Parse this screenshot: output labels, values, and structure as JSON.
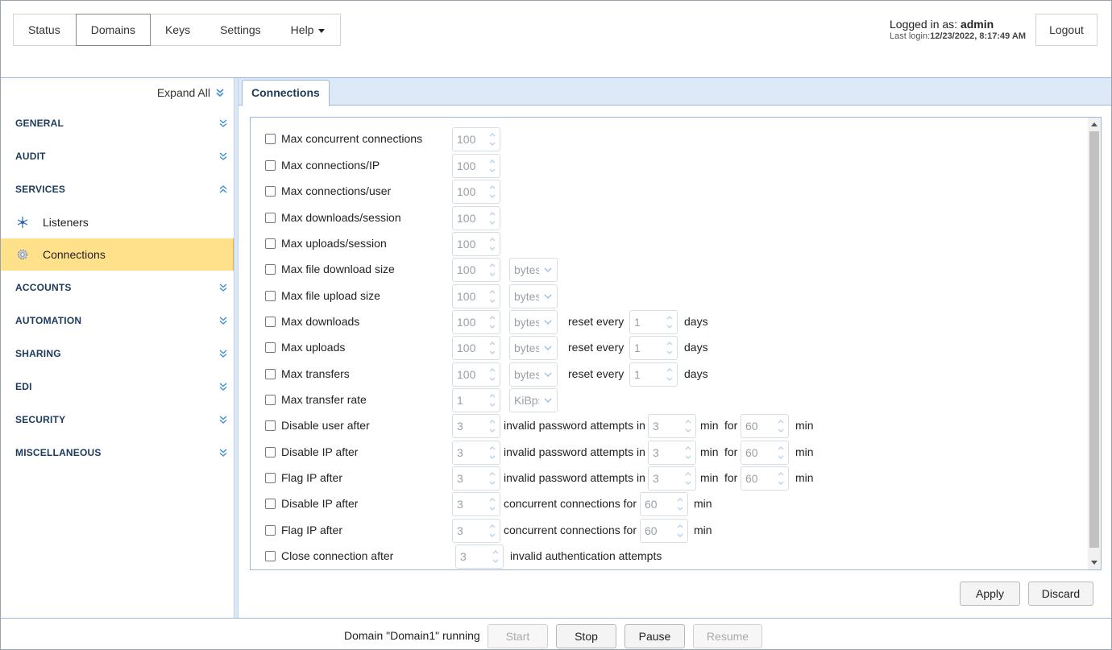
{
  "nav": {
    "items": [
      {
        "label": "Status",
        "name": "nav-status"
      },
      {
        "label": "Domains",
        "name": "nav-domains"
      },
      {
        "label": "Keys",
        "name": "nav-keys"
      },
      {
        "label": "Settings",
        "name": "nav-settings"
      },
      {
        "label": "Help",
        "name": "nav-help"
      }
    ],
    "active": "Domains"
  },
  "login": {
    "prefix": "Logged in as:",
    "user": "admin",
    "last_login_label": "Last login:",
    "last_login_value": "12/23/2022, 8:17:49 AM",
    "logout_label": "Logout"
  },
  "sidebar": {
    "expand_all": "Expand All",
    "sections": {
      "general": "GENERAL",
      "audit": "AUDIT",
      "services": "SERVICES",
      "accounts": "ACCOUNTS",
      "automation": "AUTOMATION",
      "sharing": "SHARING",
      "edi": "EDI",
      "security": "SECURITY",
      "misc": "MISCELLANEOUS"
    },
    "items": {
      "listeners": "Listeners",
      "connections": "Connections"
    }
  },
  "tab": {
    "label": "Connections"
  },
  "form": {
    "r1": {
      "label": "Max concurrent connections",
      "value": "100"
    },
    "r2": {
      "label": "Max connections/IP",
      "value": "100"
    },
    "r3": {
      "label": "Max connections/user",
      "value": "100"
    },
    "r4": {
      "label": "Max downloads/session",
      "value": "100"
    },
    "r5": {
      "label": "Max uploads/session",
      "value": "100"
    },
    "r6": {
      "label": "Max file download size",
      "value": "100",
      "unit": "bytes"
    },
    "r7": {
      "label": "Max file upload size",
      "value": "100",
      "unit": "bytes"
    },
    "r8": {
      "label": "Max downloads",
      "value": "100",
      "unit": "bytes",
      "reset_label": "reset every",
      "reset_value": "1",
      "reset_unit": "days"
    },
    "r9": {
      "label": "Max uploads",
      "value": "100",
      "unit": "bytes",
      "reset_label": "reset every",
      "reset_value": "1",
      "reset_unit": "days"
    },
    "r10": {
      "label": "Max transfers",
      "value": "100",
      "unit": "bytes",
      "reset_label": "reset every",
      "reset_value": "1",
      "reset_unit": "days"
    },
    "r11": {
      "label": "Max transfer rate",
      "value": "1",
      "unit": "KiBps"
    },
    "r12": {
      "label": "Disable user after",
      "value": "3",
      "mid": "invalid password attempts in",
      "in_value": "3",
      "in_unit": "min",
      "for_label": "for",
      "for_value": "60",
      "for_unit": "min"
    },
    "r13": {
      "label": "Disable IP after",
      "value": "3",
      "mid": "invalid password attempts in",
      "in_value": "3",
      "in_unit": "min",
      "for_label": "for",
      "for_value": "60",
      "for_unit": "min"
    },
    "r14": {
      "label": "Flag IP after",
      "value": "3",
      "mid": "invalid password attempts in",
      "in_value": "3",
      "in_unit": "min",
      "for_label": "for",
      "for_value": "60",
      "for_unit": "min"
    },
    "r15": {
      "label": "Disable IP after",
      "value": "3",
      "mid": "concurrent connections for",
      "for_value": "60",
      "for_unit": "min"
    },
    "r16": {
      "label": "Flag IP after",
      "value": "3",
      "mid": "concurrent connections for",
      "for_value": "60",
      "for_unit": "min"
    },
    "r17": {
      "label": "Close connection after",
      "value": "3",
      "mid": "invalid authentication attempts"
    }
  },
  "actions": {
    "apply": "Apply",
    "discard": "Discard"
  },
  "status": {
    "text": "Domain \"Domain1\" running",
    "start": "Start",
    "stop": "Stop",
    "pause": "Pause",
    "resume": "Resume"
  },
  "colors": {
    "accent": "#1b3a5c",
    "active_item_bg": "#ffe18c",
    "tabbar_bg": "#dde9f7",
    "border_blue": "#9fb8d8"
  }
}
